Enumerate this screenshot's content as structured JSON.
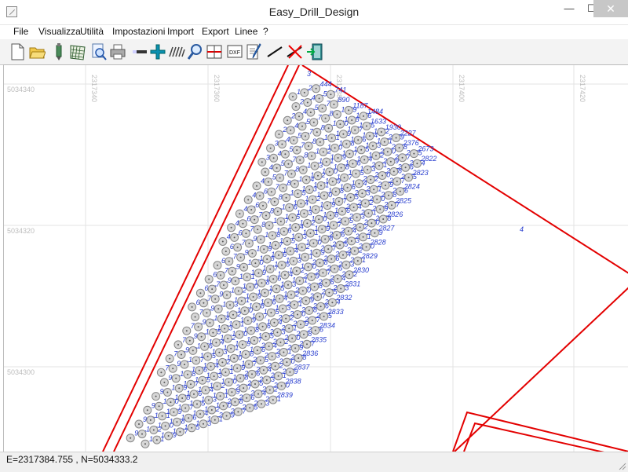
{
  "window": {
    "title": "Easy_Drill_Design",
    "minimize": "—",
    "maximize": "☐",
    "close": "✕"
  },
  "menu": [
    "File",
    "Visualizza",
    "Utilità",
    "Impostazioni",
    "Import",
    "Export",
    "Linee",
    "?"
  ],
  "toolbar": {
    "icons": [
      "new-file-icon",
      "open-folder-icon",
      "drill-bit-icon",
      "grid-pattern-icon",
      "preview-icon",
      "print-icon",
      "line-tool-icon",
      "add-point-icon",
      "drill-rows-icon",
      "zoom-icon",
      "section-icon",
      "dxf-export-icon",
      "edit-icon",
      "draw-line-icon",
      "delete-line-icon",
      "exit-icon"
    ],
    "dxf_label": "DXF"
  },
  "axes": {
    "x_ticks": [
      "2317340",
      "2317360",
      "2317380",
      "2317400",
      "2317420"
    ],
    "y_ticks": [
      "5034340",
      "5034320",
      "5034300"
    ]
  },
  "drill": {
    "top_hole_label": "3",
    "corner_label": "4",
    "label_color": "#2a3fcf",
    "boundary_color": "#e30000"
  },
  "status": {
    "coords": "E=2317384.755 , N=5034333.2"
  }
}
